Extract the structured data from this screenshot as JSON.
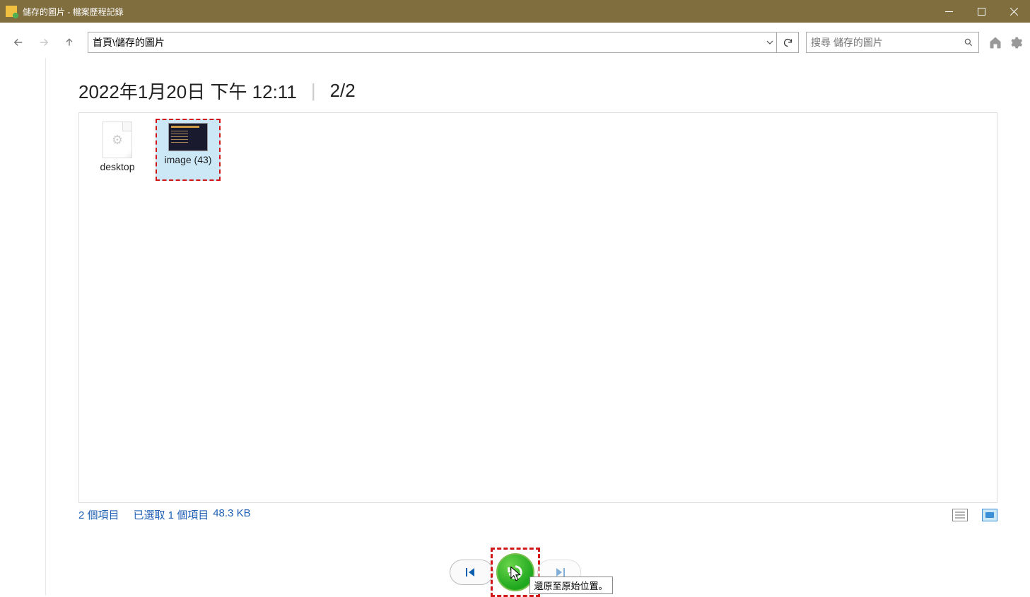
{
  "titlebar": {
    "text": "儲存的圖片 - 檔案歷程記錄"
  },
  "nav": {
    "address": "首頁\\儲存的圖片"
  },
  "search": {
    "placeholder": "搜尋 儲存的圖片"
  },
  "header": {
    "datetime": "2022年1月20日 下午 12:11",
    "page_counter": "2/2"
  },
  "files": [
    {
      "label": "desktop",
      "kind": "doc",
      "selected": false
    },
    {
      "label": "image (43)",
      "kind": "thumb",
      "selected": true
    }
  ],
  "status": {
    "item_count": "2 個項目",
    "selection": "已選取 1 個項目",
    "size": "48.3 KB"
  },
  "tooltip": "還原至原始位置。"
}
